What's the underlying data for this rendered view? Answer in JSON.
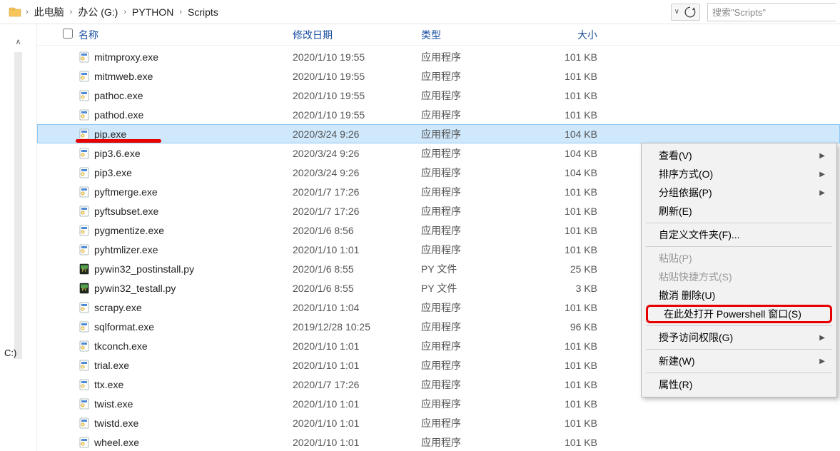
{
  "addressbar": {
    "crumbs": [
      "此电脑",
      "办公 (G:)",
      "PYTHON",
      "Scripts"
    ]
  },
  "search": {
    "placeholder": "搜索\"Scripts\""
  },
  "left": {
    "drive_label": "C:)"
  },
  "columns": {
    "name": "名称",
    "date": "修改日期",
    "type": "类型",
    "size": "大小"
  },
  "files": [
    {
      "icon": "exe",
      "name": "mitmproxy.exe",
      "date": "2020/1/10 19:55",
      "type": "应用程序",
      "size": "101 KB"
    },
    {
      "icon": "exe",
      "name": "mitmweb.exe",
      "date": "2020/1/10 19:55",
      "type": "应用程序",
      "size": "101 KB"
    },
    {
      "icon": "exe",
      "name": "pathoc.exe",
      "date": "2020/1/10 19:55",
      "type": "应用程序",
      "size": "101 KB"
    },
    {
      "icon": "exe",
      "name": "pathod.exe",
      "date": "2020/1/10 19:55",
      "type": "应用程序",
      "size": "101 KB"
    },
    {
      "icon": "exe",
      "name": "pip.exe",
      "date": "2020/3/24 9:26",
      "type": "应用程序",
      "size": "104 KB",
      "selected": true,
      "red_underline": true
    },
    {
      "icon": "exe",
      "name": "pip3.6.exe",
      "date": "2020/3/24 9:26",
      "type": "应用程序",
      "size": "104 KB"
    },
    {
      "icon": "exe",
      "name": "pip3.exe",
      "date": "2020/3/24 9:26",
      "type": "应用程序",
      "size": "104 KB"
    },
    {
      "icon": "exe",
      "name": "pyftmerge.exe",
      "date": "2020/1/7 17:26",
      "type": "应用程序",
      "size": "101 KB"
    },
    {
      "icon": "exe",
      "name": "pyftsubset.exe",
      "date": "2020/1/7 17:26",
      "type": "应用程序",
      "size": "101 KB"
    },
    {
      "icon": "exe",
      "name": "pygmentize.exe",
      "date": "2020/1/6 8:56",
      "type": "应用程序",
      "size": "101 KB"
    },
    {
      "icon": "exe",
      "name": "pyhtmlizer.exe",
      "date": "2020/1/10 1:01",
      "type": "应用程序",
      "size": "101 KB"
    },
    {
      "icon": "py",
      "name": "pywin32_postinstall.py",
      "date": "2020/1/6 8:55",
      "type": "PY 文件",
      "size": "25 KB"
    },
    {
      "icon": "py",
      "name": "pywin32_testall.py",
      "date": "2020/1/6 8:55",
      "type": "PY 文件",
      "size": "3 KB"
    },
    {
      "icon": "exe",
      "name": "scrapy.exe",
      "date": "2020/1/10 1:04",
      "type": "应用程序",
      "size": "101 KB"
    },
    {
      "icon": "exe",
      "name": "sqlformat.exe",
      "date": "2019/12/28 10:25",
      "type": "应用程序",
      "size": "96 KB"
    },
    {
      "icon": "exe",
      "name": "tkconch.exe",
      "date": "2020/1/10 1:01",
      "type": "应用程序",
      "size": "101 KB"
    },
    {
      "icon": "exe",
      "name": "trial.exe",
      "date": "2020/1/10 1:01",
      "type": "应用程序",
      "size": "101 KB"
    },
    {
      "icon": "exe",
      "name": "ttx.exe",
      "date": "2020/1/7 17:26",
      "type": "应用程序",
      "size": "101 KB"
    },
    {
      "icon": "exe",
      "name": "twist.exe",
      "date": "2020/1/10 1:01",
      "type": "应用程序",
      "size": "101 KB"
    },
    {
      "icon": "exe",
      "name": "twistd.exe",
      "date": "2020/1/10 1:01",
      "type": "应用程序",
      "size": "101 KB"
    },
    {
      "icon": "exe",
      "name": "wheel.exe",
      "date": "2020/1/10 1:01",
      "type": "应用程序",
      "size": "101 KB"
    }
  ],
  "context_menu": {
    "items": [
      {
        "label": "查看(V)",
        "sub": true
      },
      {
        "label": "排序方式(O)",
        "sub": true
      },
      {
        "label": "分组依据(P)",
        "sub": true
      },
      {
        "label": "刷新(E)"
      },
      {
        "separator": true
      },
      {
        "label": "自定义文件夹(F)..."
      },
      {
        "separator": true
      },
      {
        "label": "粘贴(P)",
        "disabled": true
      },
      {
        "label": "粘贴快捷方式(S)",
        "disabled": true
      },
      {
        "label": "撤消 删除(U)"
      },
      {
        "label": "在此处打开 Powershell 窗口(S)",
        "highlight": true
      },
      {
        "separator": true
      },
      {
        "label": "授予访问权限(G)",
        "sub": true
      },
      {
        "separator": true
      },
      {
        "label": "新建(W)",
        "sub": true
      },
      {
        "separator": true
      },
      {
        "label": "属性(R)"
      }
    ]
  }
}
